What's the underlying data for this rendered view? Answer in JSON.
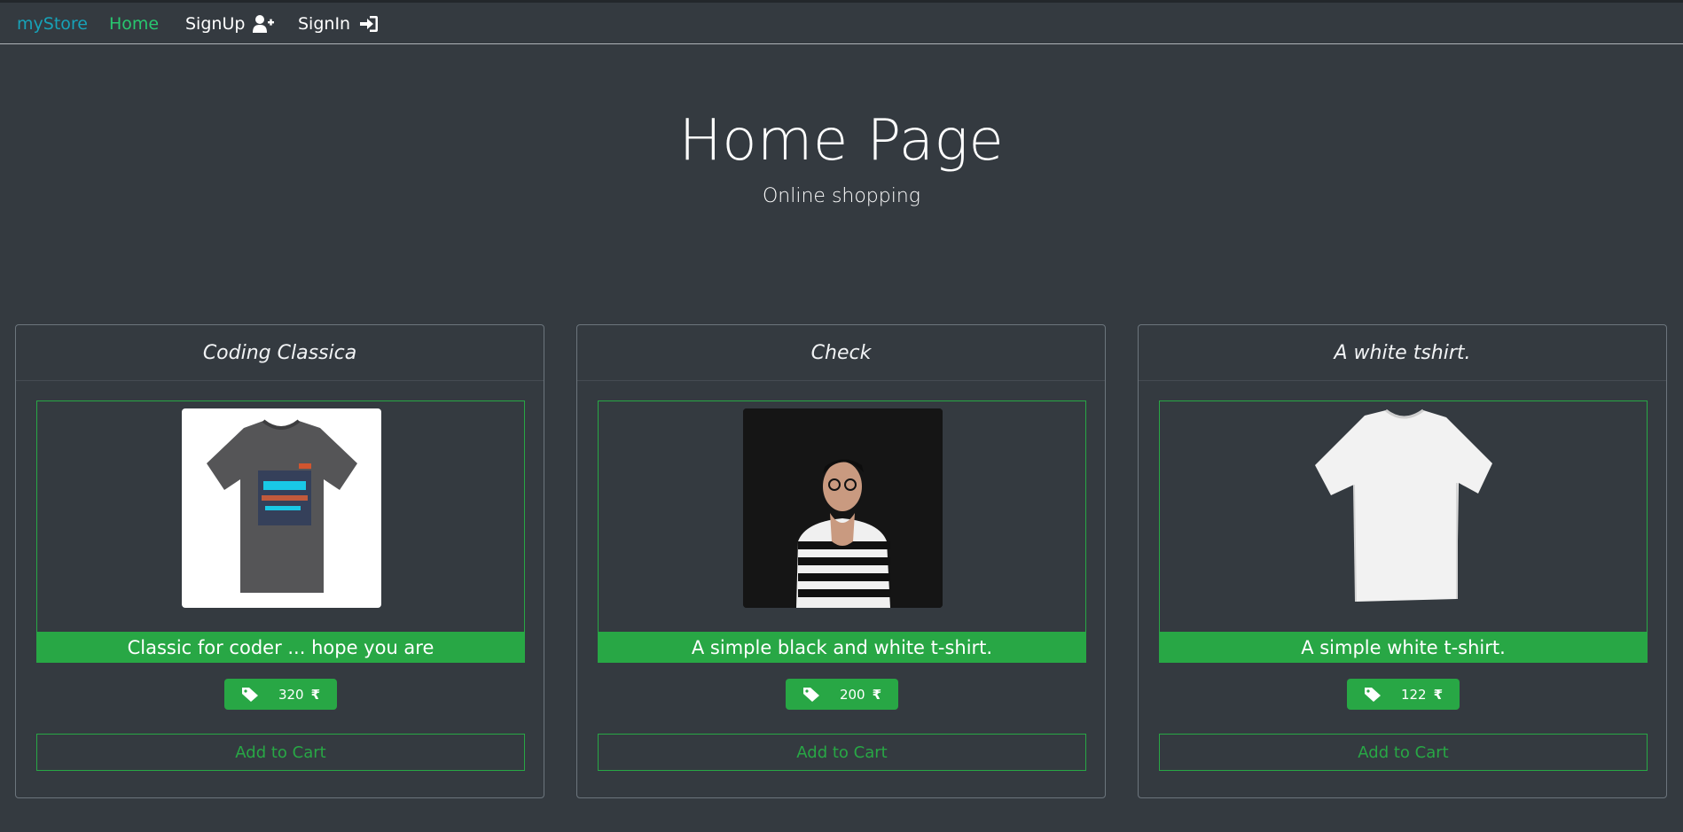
{
  "nav": {
    "brand": "myStore",
    "home": "Home",
    "signup": "SignUp",
    "signin": "SignIn"
  },
  "hero": {
    "title": "Home Page",
    "subtitle": "Online shopping"
  },
  "products": [
    {
      "name": "Coding Classica",
      "description": "Classic for coder ... hope you are",
      "price": "320",
      "currency_symbol": "₹",
      "button": "Add to Cart",
      "image_icon": "grey-tshirt-image"
    },
    {
      "name": "Check",
      "description": "A simple black and white t-shirt.",
      "price": "200",
      "currency_symbol": "₹",
      "button": "Add to Cart",
      "image_icon": "man-striped-tshirt-photo"
    },
    {
      "name": "A white tshirt.",
      "description": "A simple white t-shirt.",
      "price": "122",
      "currency_symbol": "₹",
      "button": "Add to Cart",
      "image_icon": "white-tshirt-image"
    }
  ],
  "colors": {
    "background": "#343a40",
    "brand": "#17a2b8",
    "accent_green": "#28a745"
  }
}
